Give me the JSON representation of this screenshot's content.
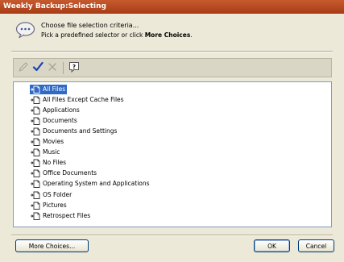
{
  "window": {
    "title": "Weekly Backup:Selecting"
  },
  "header": {
    "icon": "speech-bubble-icon",
    "title": "Choose file selection criteria...",
    "subtitle_prefix": "Pick a predefined selector or click ",
    "subtitle_bold": "More Choices",
    "subtitle_suffix": "."
  },
  "toolbar": {
    "buttons": [
      {
        "icon": "edit-icon"
      },
      {
        "icon": "checkmark-icon"
      },
      {
        "icon": "x-icon"
      },
      {
        "icon": "help-icon"
      }
    ]
  },
  "tree": {
    "selected": "All Files",
    "items": [
      {
        "label": "All Files",
        "icon": "selector-icon"
      },
      {
        "label": "All Files Except Cache Files",
        "icon": "selector-icon"
      },
      {
        "label": "Applications",
        "icon": "selector-icon"
      },
      {
        "label": "Documents",
        "icon": "selector-icon"
      },
      {
        "label": "Documents and Settings",
        "icon": "selector-icon"
      },
      {
        "label": "Movies",
        "icon": "selector-icon"
      },
      {
        "label": "Music",
        "icon": "selector-icon"
      },
      {
        "label": "No Files",
        "icon": "selector-icon"
      },
      {
        "label": "Office Documents",
        "icon": "selector-icon"
      },
      {
        "label": "Operating System and Applications",
        "icon": "selector-icon"
      },
      {
        "label": "OS Folder",
        "icon": "selector-icon"
      },
      {
        "label": "Pictures",
        "icon": "selector-icon"
      },
      {
        "label": "Retrospect Files",
        "icon": "selector-icon"
      }
    ]
  },
  "footer": {
    "more_choices_label": "More Choices...",
    "ok_label": "OK",
    "cancel_label": "Cancel"
  },
  "colors": {
    "titlebar": "#b3461f",
    "selection": "#316ac5",
    "checkmark": "#1a3fb8"
  }
}
